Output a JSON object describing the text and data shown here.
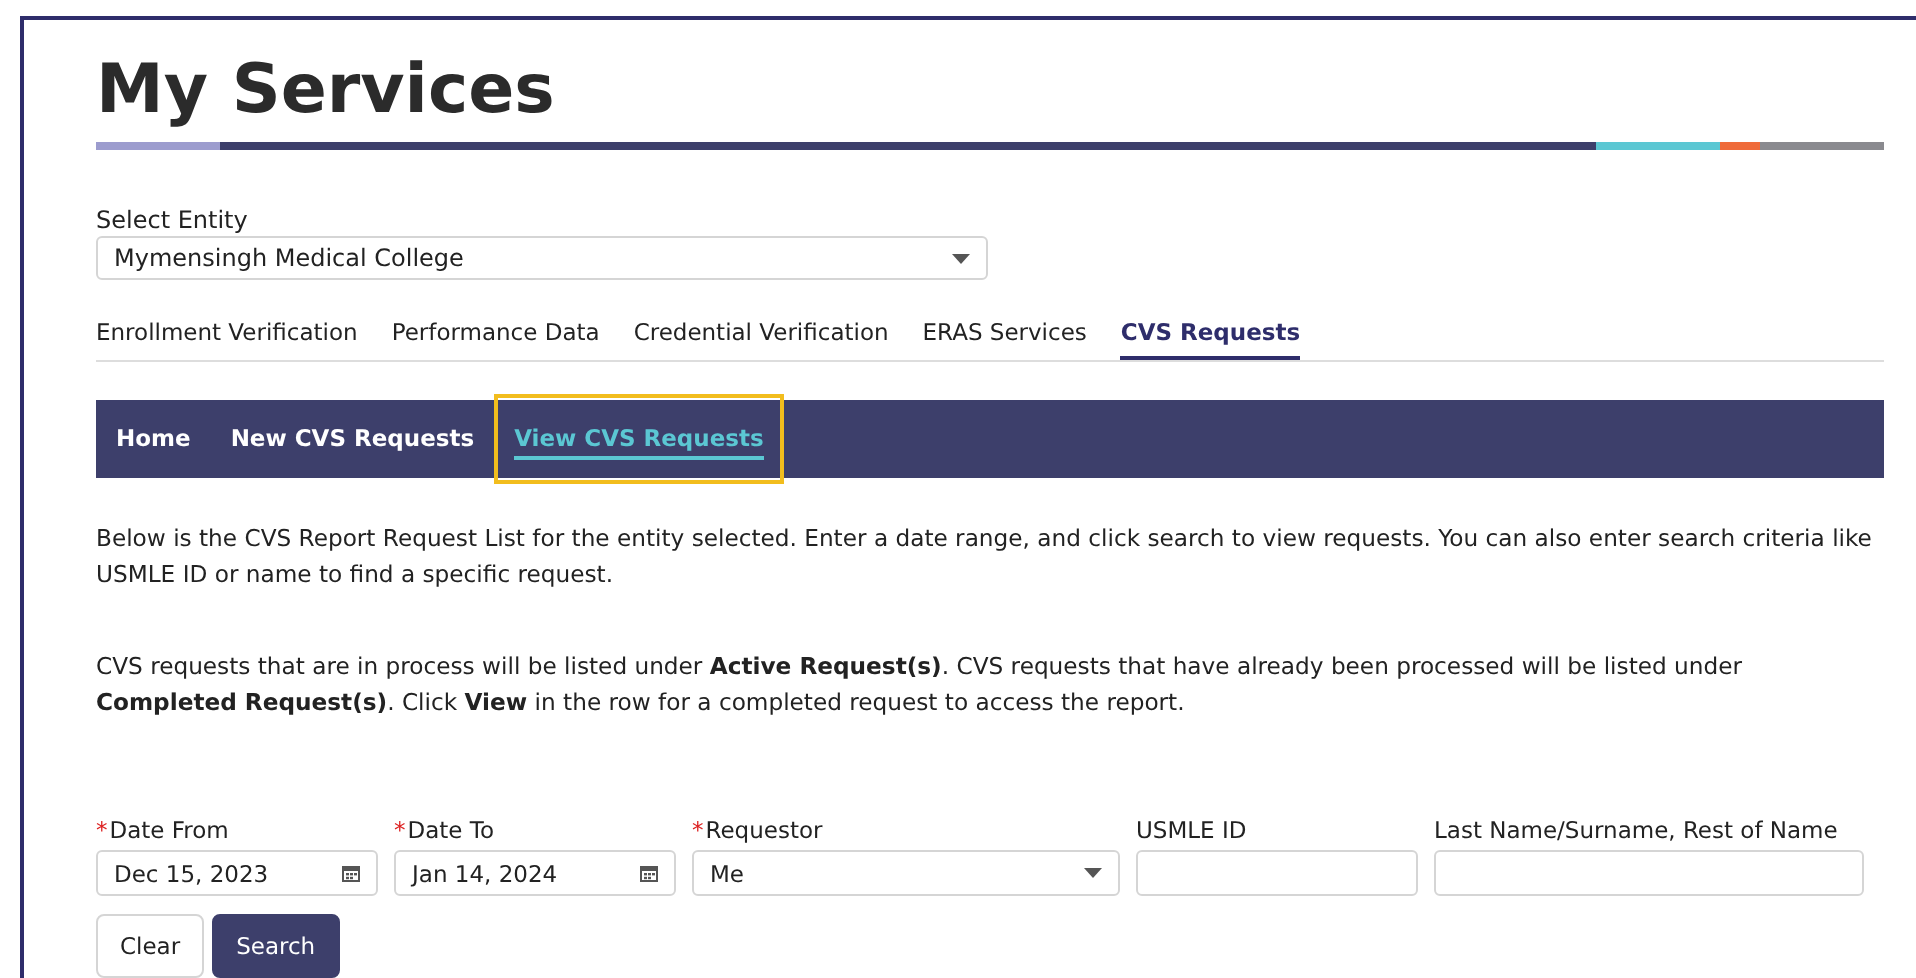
{
  "page": {
    "title": "My Services"
  },
  "entity": {
    "label": "Select Entity",
    "value": "Mymensingh Medical College"
  },
  "tabs": [
    {
      "label": "Enrollment Verification",
      "selected": false
    },
    {
      "label": "Performance Data",
      "selected": false
    },
    {
      "label": "Credential Verification",
      "selected": false
    },
    {
      "label": "ERAS Services",
      "selected": false
    },
    {
      "label": "CVS Requests",
      "selected": true
    }
  ],
  "subnav": [
    {
      "label": "Home",
      "selected": false,
      "highlighted": false
    },
    {
      "label": "New CVS Requests",
      "selected": false,
      "highlighted": false
    },
    {
      "label": "View CVS Requests",
      "selected": true,
      "highlighted": true
    }
  ],
  "paragraphs": [
    "Below is the CVS Report Request List for the entity selected. Enter a date range, and click search to view requests. You can also enter search criteria like USMLE ID or name to find a specific request.",
    "CVS requests that are in process will be listed under **Active Request(s)**. CVS requests that have already been processed will be listed under **Completed Request(s)**. Click **View** in the row for a completed request to access the report."
  ],
  "filters": [
    {
      "kind": "date",
      "label": "Date From",
      "required_mark": "*",
      "value": "Dec 15, 2023"
    },
    {
      "kind": "date",
      "label": "Date To",
      "required_mark": "*",
      "value": "Jan 14, 2024"
    },
    {
      "kind": "select",
      "label": "Requestor",
      "required_mark": "*",
      "value": "Me"
    },
    {
      "kind": "text",
      "label": "USMLE ID"
    },
    {
      "kind": "text",
      "label": "Last Name/Surname, Rest of Name"
    }
  ],
  "buttons": [
    {
      "label": "Clear",
      "kind": "secondary"
    },
    {
      "label": "Search",
      "kind": "primary"
    }
  ]
}
